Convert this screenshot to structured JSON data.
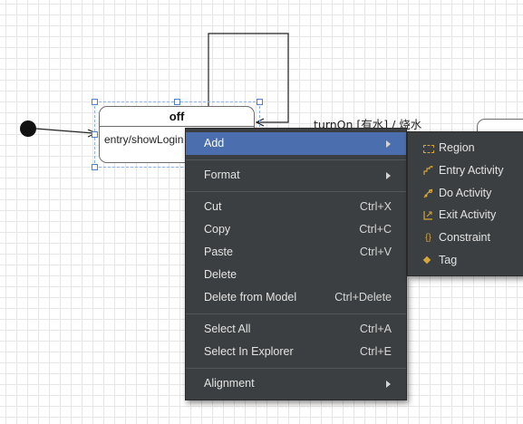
{
  "diagram": {
    "state_name": "off",
    "state_entry": "entry/showLogin",
    "transition_label": "turnOn [有水] / 烧水"
  },
  "context_menu": {
    "items": [
      {
        "label": "Add",
        "shortcut": "",
        "submenu": true,
        "highlighted": true
      },
      {
        "label": "Format",
        "shortcut": "",
        "submenu": true
      },
      {
        "label": "Cut",
        "shortcut": "Ctrl+X"
      },
      {
        "label": "Copy",
        "shortcut": "Ctrl+C"
      },
      {
        "label": "Paste",
        "shortcut": "Ctrl+V"
      },
      {
        "label": "Delete",
        "shortcut": ""
      },
      {
        "label": "Delete from Model",
        "shortcut": "Ctrl+Delete"
      },
      {
        "label": "Select All",
        "shortcut": "Ctrl+A"
      },
      {
        "label": "Select In Explorer",
        "shortcut": "Ctrl+E"
      },
      {
        "label": "Alignment",
        "shortcut": "",
        "submenu": true
      }
    ]
  },
  "add_submenu": {
    "items": [
      {
        "label": "Region",
        "icon": "region-icon"
      },
      {
        "label": "Entry Activity",
        "icon": "entry-activity-icon"
      },
      {
        "label": "Do Activity",
        "icon": "do-activity-icon"
      },
      {
        "label": "Exit Activity",
        "icon": "exit-activity-icon"
      },
      {
        "label": "Constraint",
        "icon": "constraint-icon"
      },
      {
        "label": "Tag",
        "icon": "tag-icon"
      }
    ]
  },
  "colors": {
    "menu_background": "#3c3f41",
    "menu_highlight": "#4b6eaf",
    "icon_accent": "#d4a63c",
    "selection_handle": "#4a7fd1"
  }
}
